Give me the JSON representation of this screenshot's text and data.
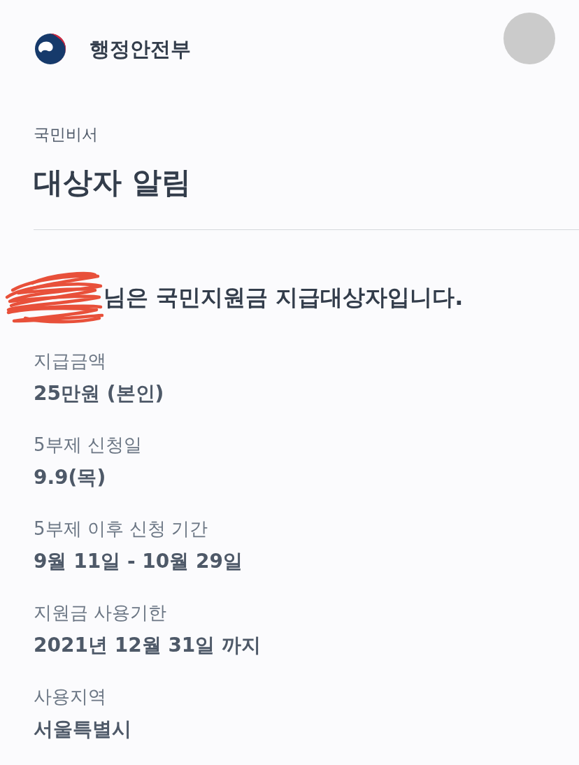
{
  "header": {
    "org_name": "행정안전부"
  },
  "service": {
    "label": "국민비서",
    "title": "대상자 알림"
  },
  "notice": {
    "message": "님은 국민지원금 지급대상자입니다."
  },
  "details": [
    {
      "label": "지급금액",
      "value": "25만원 (본인)"
    },
    {
      "label": "5부제 신청일",
      "value": "9.9(목)"
    },
    {
      "label": "5부제 이후 신청 기간",
      "value": "9월 11일 - 10월 29일"
    },
    {
      "label": "지원금 사용기한",
      "value": "2021년 12월 31일 까지"
    },
    {
      "label": "사용지역",
      "value": "서울특별시"
    }
  ]
}
